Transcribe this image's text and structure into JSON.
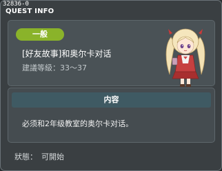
{
  "window": {
    "id": "32836-0",
    "title": "QUEST INFO"
  },
  "quest": {
    "category": "一般",
    "name": "[好友故事]和奥尔卡对话",
    "level": "建議等級：33～37",
    "npc_icon": "npc-portrait-girl-blonde-twintails"
  },
  "content": {
    "header": "内容",
    "text": "必须和2年级教室的奥尔卡对话。"
  },
  "status": {
    "label": "狀態：",
    "value": "可開始"
  },
  "colors": {
    "badge": "#8ab32a",
    "content_header": "#3f5a63",
    "background": "#3a3f42"
  }
}
